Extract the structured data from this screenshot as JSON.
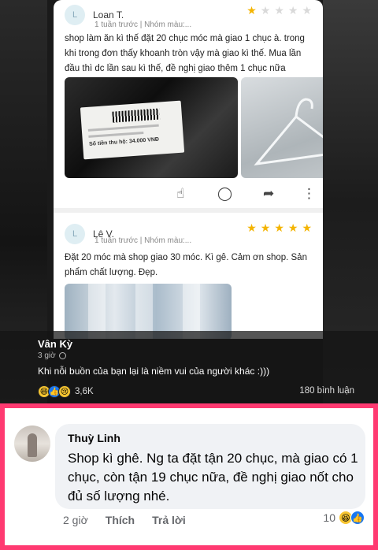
{
  "review1": {
    "avatar": "L",
    "name": "Loan T.",
    "meta": "1 tuần trước | Nhóm màu:...",
    "stars": 1,
    "text": "shop làm ăn kì thế đặt 20 chục móc mà giao 1 chục à. trong khi trong đơn thấy khoanh tròn vậy mà giao kì thế. Mua lần đầu thì dc lần sau kì thế, đề nghị giao thêm 1 chục nữa",
    "label_price": "Số tiền thu hộ: 34.000 VNĐ",
    "icons": [
      "clap-icon",
      "comment-icon",
      "share-icon",
      "more-icon"
    ]
  },
  "review2": {
    "avatar": "L",
    "name": "Lê V.",
    "meta": "1 tuần trước | Nhóm màu:...",
    "stars": 5,
    "text": "Đặt 20 móc mà shop giao 30 móc. Kì gê. Cảm ơn shop. Sản phẩm chất lượng. Đẹp."
  },
  "post": {
    "author": "Vân Kỳ",
    "time": "3 giờ",
    "caption": "Khi nỗi buồn của bạn lại là niềm vui của người khác :)))",
    "reaction_count": "3,6K",
    "comment_count": "180 bình luận"
  },
  "comment": {
    "name": "Thuỳ Linh",
    "text": "Shop kì ghê. Ng ta đặt tận 20 chục, mà giao có 1 chục, còn tận 19 chục nữa, đề nghị giao nốt cho đủ số lượng nhé.",
    "time": "2 giờ",
    "like_label": "Thích",
    "reply_label": "Trả lời",
    "reaction_count": "10"
  },
  "colors": {
    "frame": "#ff3a71",
    "star": "#f4b400",
    "like_blue": "#1877f2"
  }
}
